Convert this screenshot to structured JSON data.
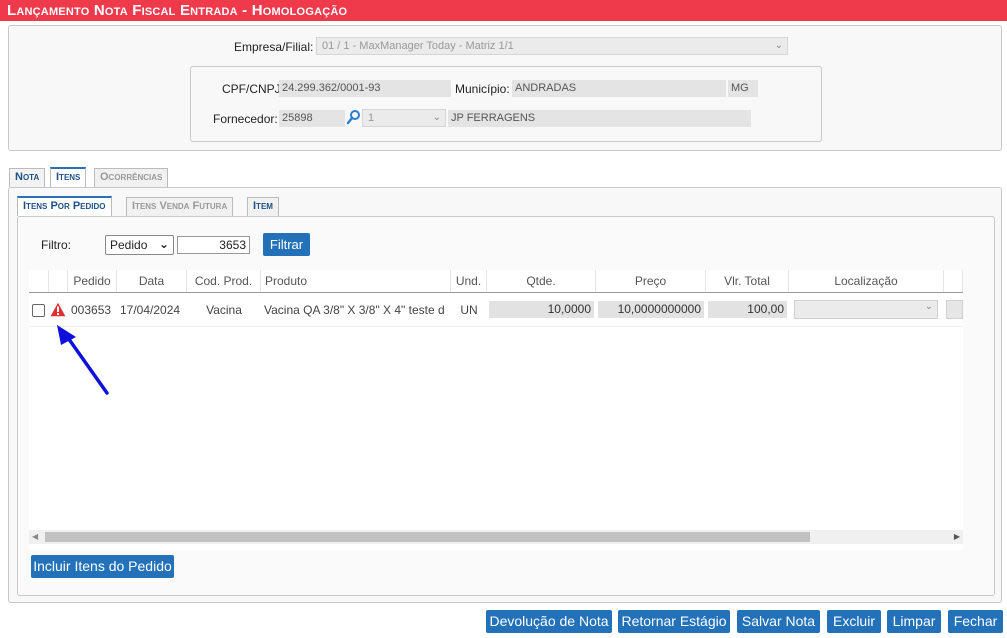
{
  "title": "Lançamento Nota Fiscal Entrada  - Homologação",
  "header": {
    "empresa_label": "Empresa/Filial:",
    "empresa_value": "01 / 1 - MaxManager Today - Matriz 1/1",
    "cpf_label": "CPF/CNPJ:",
    "cpf_value": "24.299.362/0001-93",
    "municipio_label": "Município:",
    "municipio_value": "ANDRADAS",
    "uf_value": "MG",
    "fornecedor_label": "Fornecedor:",
    "fornecedor_code": "25898",
    "fornecedor_seq": "1",
    "fornecedor_name": "JP FERRAGENS"
  },
  "tabs": [
    "Nota",
    "Itens",
    "Ocorrências"
  ],
  "subtabs": [
    "Itens Por Pedido",
    "Itens Venda Futura",
    "Item"
  ],
  "filter": {
    "label": "Filtro:",
    "select_value": "Pedido",
    "input_value": "3653",
    "button": "Filtrar"
  },
  "table": {
    "columns": [
      "Pedido",
      "Data",
      "Cod. Prod.",
      "Produto",
      "Und.",
      "Qtde.",
      "Preço",
      "Vlr. Total",
      "Localização"
    ],
    "rows": [
      {
        "pedido": "003653",
        "data": "17/04/2024",
        "cod": "Vacina",
        "produto": "Vacina QA 3/8\" X 3/8\" X 4\" teste d",
        "und": "UN",
        "qtde": "10,0000",
        "preco": "10,0000000000",
        "total": "100,00",
        "localizacao": ""
      }
    ]
  },
  "buttons": {
    "incluir": "Incluir Itens do Pedido",
    "devolucao": "Devolução de Nota",
    "retornar": "Retornar Estágio",
    "salvar": "Salvar Nota",
    "excluir": "Excluir",
    "limpar": "Limpar",
    "fechar": "Fechar"
  },
  "colors": {
    "titlebar": "#ef3a4c",
    "button": "#2271b9",
    "warning": "#e03030",
    "arrow": "#1010dd"
  }
}
